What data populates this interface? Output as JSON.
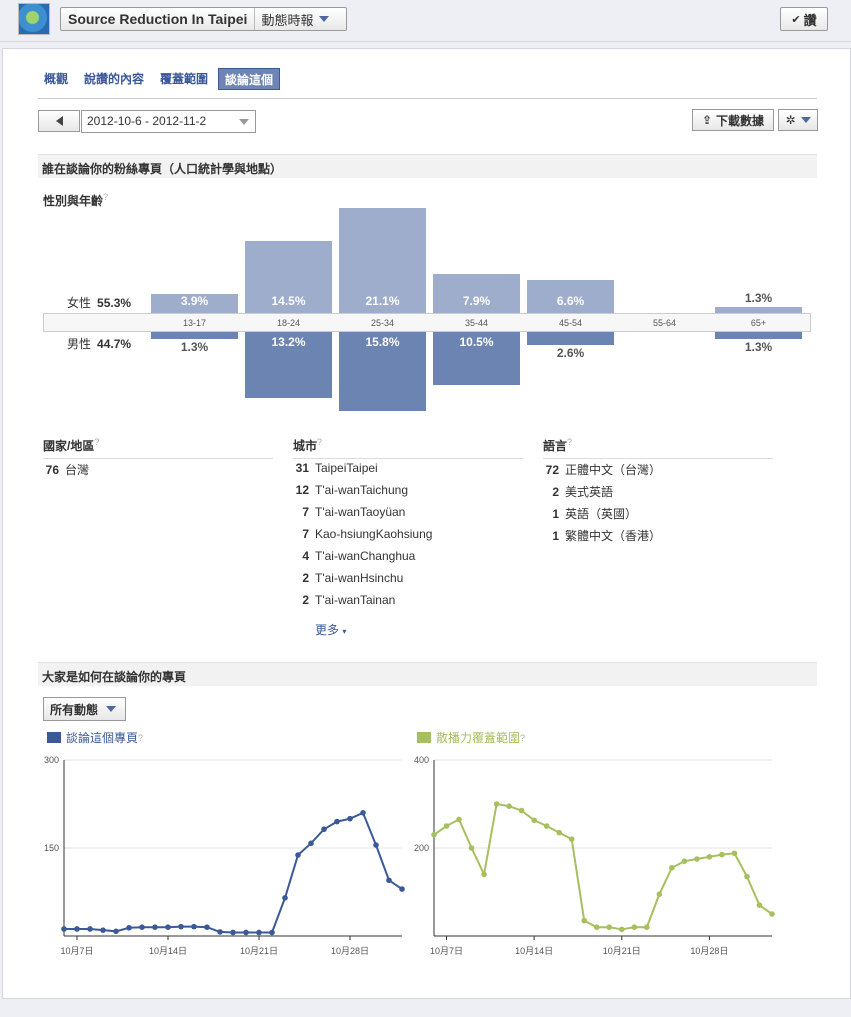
{
  "page": {
    "name": "Source Reduction In Taipei",
    "menu": "動態時報",
    "like": "讚"
  },
  "tabs": [
    "概觀",
    "說讚的內容",
    "覆蓋範圍",
    "談論這個"
  ],
  "date_range": "2012-10-6 - 2012-11-2",
  "download_label": "下載數據",
  "section1": "誰在談論你的粉絲專頁（人口統計學與地點）",
  "gender_age_title": "性別與年齡",
  "female": {
    "label": "女性",
    "pct": "55.3%"
  },
  "male": {
    "label": "男性",
    "pct": "44.7%"
  },
  "age_groups": [
    "13-17",
    "18-24",
    "25-34",
    "35-44",
    "45-54",
    "55-64",
    "65+"
  ],
  "female_values": [
    3.9,
    14.5,
    21.1,
    7.9,
    6.6,
    0,
    1.3
  ],
  "female_labels": [
    "3.9%",
    "14.5%",
    "21.1%",
    "7.9%",
    "6.6%",
    "",
    "1.3%"
  ],
  "male_values": [
    1.3,
    13.2,
    15.8,
    10.5,
    2.6,
    0,
    1.3
  ],
  "male_labels": [
    "1.3%",
    "13.2%",
    "15.8%",
    "10.5%",
    "2.6%",
    "",
    "1.3%"
  ],
  "countries": {
    "title": "國家/地區",
    "rows": [
      {
        "n": "76",
        "name": "台灣"
      }
    ]
  },
  "cities": {
    "title": "城市",
    "rows": [
      {
        "n": "31",
        "name": "TaipeiTaipei"
      },
      {
        "n": "12",
        "name": "T'ai-wanTaichung"
      },
      {
        "n": "7",
        "name": "T'ai-wanTaoyüan"
      },
      {
        "n": "7",
        "name": "Kao-hsiungKaohsiung"
      },
      {
        "n": "4",
        "name": "T'ai-wanChanghua"
      },
      {
        "n": "2",
        "name": "T'ai-wanHsinchu"
      },
      {
        "n": "2",
        "name": "T'ai-wanTainan"
      }
    ]
  },
  "languages": {
    "title": "語言",
    "rows": [
      {
        "n": "72",
        "name": "正體中文（台灣）"
      },
      {
        "n": "2",
        "name": "美式英語"
      },
      {
        "n": "1",
        "name": "英語（英國）"
      },
      {
        "n": "1",
        "name": "繁體中文（香港）"
      }
    ]
  },
  "more_label": "更多",
  "section2": "大家是如何在談論你的專頁",
  "filter_label": "所有動態",
  "colors": {
    "talking": "#3b5998",
    "reach": "#a6bf5f",
    "female": "#9eadcc",
    "male": "#6c84b1"
  },
  "chart_data": [
    {
      "type": "line",
      "legend": "談論這個專頁",
      "x_tick_labels": [
        "10月7日",
        "10月14日",
        "10月21日",
        "10月28日"
      ],
      "yticks": [
        150,
        300
      ],
      "ylim": [
        0,
        300
      ],
      "values": [
        12,
        12,
        12,
        10,
        8,
        14,
        15,
        15,
        15,
        16,
        16,
        15,
        7,
        6,
        6,
        6,
        6,
        65,
        138,
        158,
        182,
        195,
        200,
        210,
        155,
        95,
        80
      ]
    },
    {
      "type": "line",
      "legend": "散播力覆蓋範圍",
      "x_tick_labels": [
        "10月7日",
        "10月14日",
        "10月21日",
        "10月28日"
      ],
      "yticks": [
        200,
        400
      ],
      "ylim": [
        0,
        400
      ],
      "values": [
        230,
        250,
        265,
        200,
        140,
        300,
        295,
        285,
        263,
        250,
        235,
        220,
        35,
        20,
        20,
        15,
        20,
        20,
        95,
        155,
        170,
        175,
        180,
        185,
        188,
        135,
        70,
        50
      ]
    }
  ]
}
